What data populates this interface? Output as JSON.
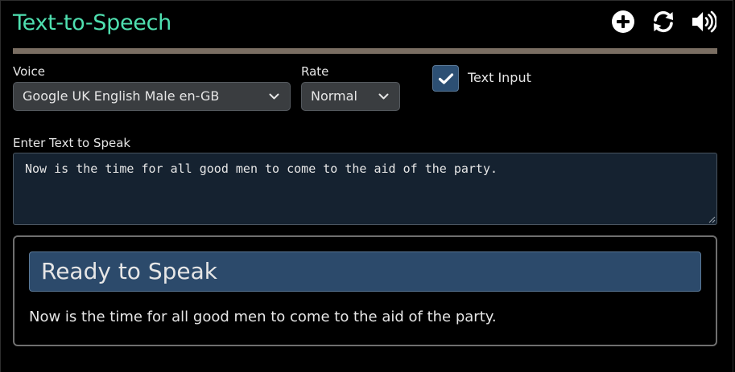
{
  "app": {
    "title": "Text-to-Speech",
    "accent_color": "#4fe0b0"
  },
  "header": {
    "icons": [
      "plus-circle-icon",
      "refresh-icon",
      "speaker-icon"
    ]
  },
  "voice": {
    "label": "Voice",
    "selected": "Google UK English Male en-GB"
  },
  "rate": {
    "label": "Rate",
    "selected": "Normal"
  },
  "text_input_toggle": {
    "label": "Text Input",
    "checked": true
  },
  "text_entry": {
    "label": "Enter Text to Speak",
    "value": "Now is the time for all good men to come to the aid of the party."
  },
  "output": {
    "status": "Ready to Speak",
    "text": "Now is the time for all good men to come to the aid of the party."
  }
}
